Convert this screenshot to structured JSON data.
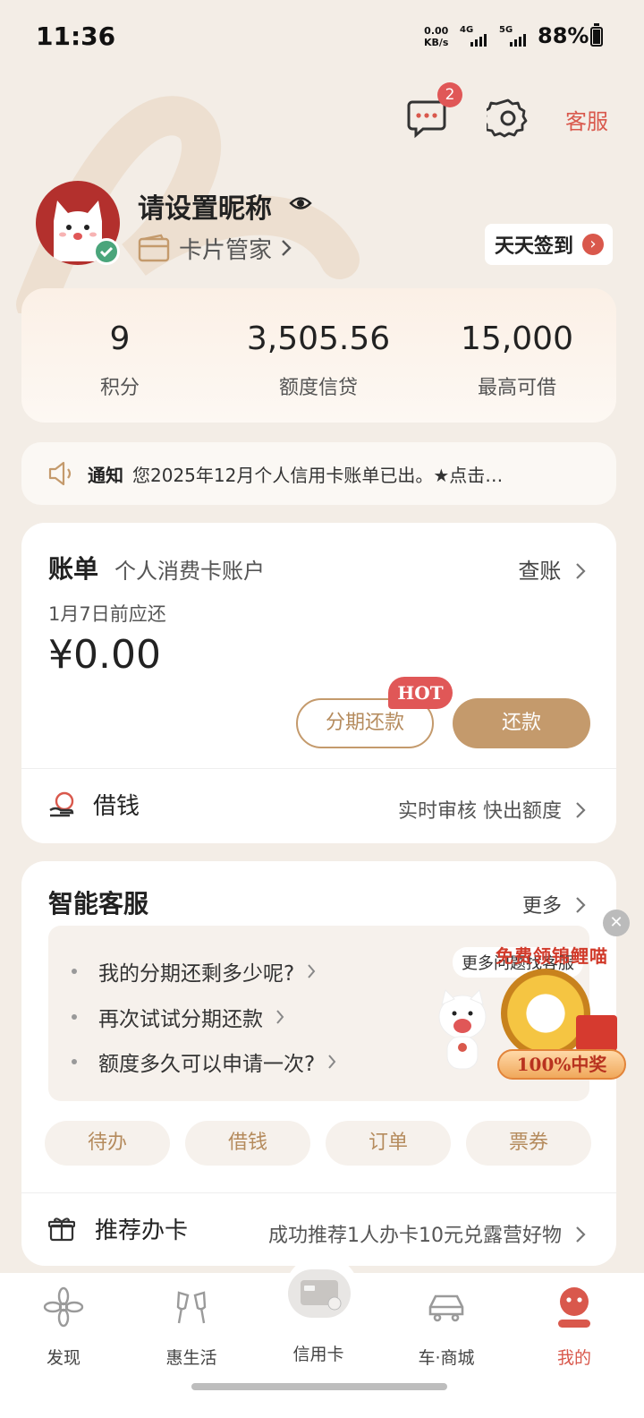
{
  "status_bar": {
    "time": "11:36",
    "net_speed_value": "0.00",
    "net_speed_unit": "KB/s",
    "sig1_label": "4G",
    "sig2_label": "5G",
    "battery": "88%"
  },
  "header": {
    "message_badge": "2",
    "customer_service": "客服"
  },
  "profile": {
    "nickname": "请设置昵称",
    "card_manager": "卡片管家",
    "checkin": "天天签到"
  },
  "stats": [
    {
      "value": "9",
      "label": "积分"
    },
    {
      "value": "3,505.56",
      "label": "额度信贷"
    },
    {
      "value": "15,000",
      "label": "最高可借"
    }
  ],
  "notice": {
    "tag": "通知",
    "message": "您2025年12月个人信用卡账单已出。★点击…"
  },
  "bill": {
    "title": "账单",
    "account": "个人消费卡账户",
    "check_link": "查账",
    "due_text": "1月7日前应还",
    "amount": "¥0.00",
    "hot_tag": "HOT",
    "installment_button": "分期还款",
    "repay_button": "还款",
    "borrow_label": "借钱",
    "borrow_desc": "实时审核 快出额度"
  },
  "smart_service": {
    "title": "智能客服",
    "more": "更多",
    "questions": [
      "我的分期还剩多少呢?",
      "再次试试分期还款",
      "额度多久可以申请一次?"
    ],
    "bubble": "更多问题找客服",
    "chips": [
      "待办",
      "借钱",
      "订单",
      "票券"
    ],
    "recommend_label": "推荐办卡",
    "recommend_desc": "成功推荐1人办卡10元兑露营好物"
  },
  "promo": {
    "title": "免费领锦鲤喵",
    "ribbon": "100%中奖"
  },
  "tabs": [
    {
      "label": "发现",
      "icon": "flower-icon"
    },
    {
      "label": "惠生活",
      "icon": "cheers-icon"
    },
    {
      "label": "信用卡",
      "icon": "credit-card-icon"
    },
    {
      "label": "车·商城",
      "icon": "car-icon"
    },
    {
      "label": "我的",
      "icon": "profile-face-icon"
    }
  ],
  "colors": {
    "background": "#f3ede6",
    "accent_gold": "#c49a6c",
    "accent_red": "#d9584c",
    "badge_red": "#e05757"
  }
}
